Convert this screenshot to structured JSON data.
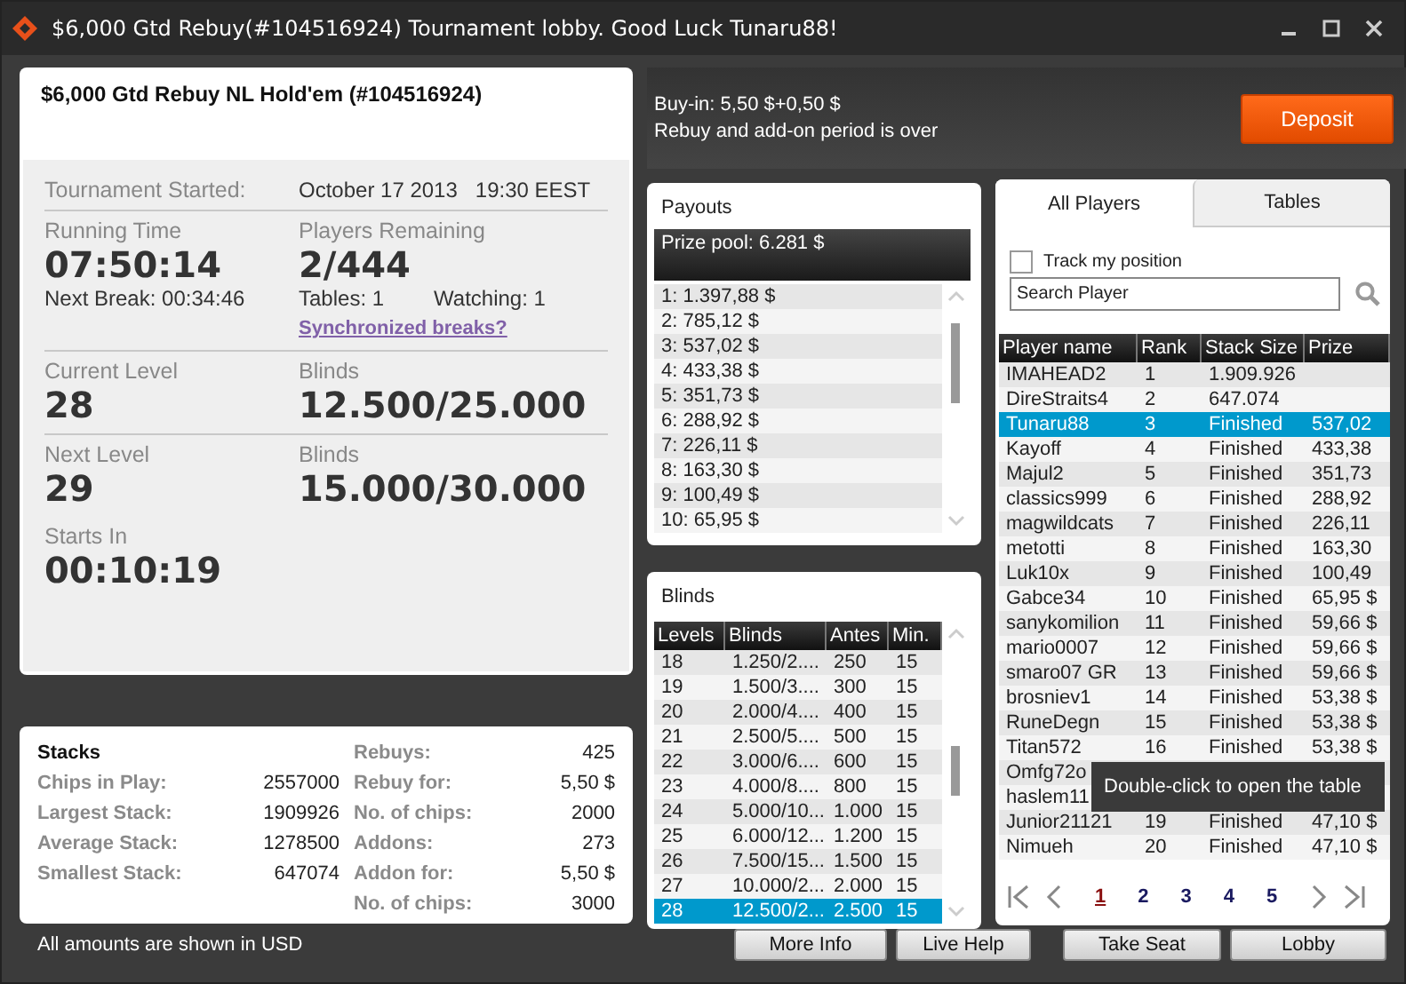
{
  "window": {
    "title": "$6,000 Gtd Rebuy(#104516924) Tournament lobby. Good Luck Tunaru88!"
  },
  "tournament": {
    "name": "$6,000 Gtd Rebuy NL Hold'em (#104516924)",
    "started_label": "Tournament Started:",
    "started_date": "October 17 2013",
    "started_time": "19:30 EEST"
  },
  "running_time": {
    "label": "Running Time",
    "value": "07:50:14"
  },
  "next_break": "Next Break: 00:34:46",
  "players_remaining": {
    "label": "Players Remaining",
    "value": "2/444"
  },
  "tables": "Tables: 1",
  "watching": "Watching: 1",
  "sync_link": "Synchronized breaks?",
  "current_level": {
    "label": "Current Level",
    "value": "28"
  },
  "current_blinds": {
    "label": "Blinds",
    "value": "12.500/25.000"
  },
  "next_level": {
    "label": "Next Level",
    "value": "29"
  },
  "next_blinds": {
    "label": "Blinds",
    "value": "15.000/30.000"
  },
  "starts_in": {
    "label": "Starts In",
    "value": "00:10:19"
  },
  "stacks": {
    "title": "Stacks",
    "rows": [
      {
        "label": "Chips in Play:",
        "value": "2557000"
      },
      {
        "label": "Largest Stack:",
        "value": "1909926"
      },
      {
        "label": "Average Stack:",
        "value": "1278500"
      },
      {
        "label": "Smallest Stack:",
        "value": "647074"
      }
    ]
  },
  "rebuys": {
    "rows": [
      {
        "label": "Rebuys:",
        "value": "425"
      },
      {
        "label": "Rebuy for:",
        "value": "5,50 $"
      },
      {
        "label": "No. of chips:",
        "value": "2000"
      },
      {
        "label": "Addons:",
        "value": "273"
      },
      {
        "label": "Addon for:",
        "value": "5,50 $"
      },
      {
        "label": "No. of chips:",
        "value": "3000"
      }
    ]
  },
  "buyin": {
    "line1": "Buy-in: 5,50 $+0,50 $",
    "line2": "Rebuy and add-on period is over"
  },
  "deposit_button": "Deposit",
  "payouts": {
    "title": "Payouts",
    "prize_pool": "Prize pool: 6.281 $",
    "items": [
      "1: 1.397,88 $",
      "2: 785,12 $",
      "3: 537,02 $",
      "4: 433,38 $",
      "5: 351,73 $",
      "6: 288,92 $",
      "7: 226,11 $",
      "8: 163,30 $",
      "9: 100,49 $",
      "10: 65,95 $"
    ]
  },
  "blinds": {
    "title": "Blinds",
    "columns": [
      "Levels",
      "Blinds",
      "Antes",
      "Min."
    ],
    "rows": [
      {
        "cells": [
          "18",
          "1.250/2....",
          "250",
          "15"
        ],
        "selected": false
      },
      {
        "cells": [
          "19",
          "1.500/3....",
          "300",
          "15"
        ],
        "selected": false
      },
      {
        "cells": [
          "20",
          "2.000/4....",
          "400",
          "15"
        ],
        "selected": false
      },
      {
        "cells": [
          "21",
          "2.500/5....",
          "500",
          "15"
        ],
        "selected": false
      },
      {
        "cells": [
          "22",
          "3.000/6....",
          "600",
          "15"
        ],
        "selected": false
      },
      {
        "cells": [
          "23",
          "4.000/8....",
          "800",
          "15"
        ],
        "selected": false
      },
      {
        "cells": [
          "24",
          "5.000/10...",
          "1.000",
          "15"
        ],
        "selected": false
      },
      {
        "cells": [
          "25",
          "6.000/12...",
          "1.200",
          "15"
        ],
        "selected": false
      },
      {
        "cells": [
          "26",
          "7.500/15...",
          "1.500",
          "15"
        ],
        "selected": false
      },
      {
        "cells": [
          "27",
          "10.000/2...",
          "2.000",
          "15"
        ],
        "selected": false
      },
      {
        "cells": [
          "28",
          "12.500/2...",
          "2.500",
          "15"
        ],
        "selected": true
      }
    ]
  },
  "players": {
    "tabs": [
      {
        "label": "All Players",
        "selected": true
      },
      {
        "label": "Tables",
        "selected": false
      }
    ],
    "track": {
      "label": "Track my position",
      "checked": false
    },
    "search": {
      "placeholder": "Search Player"
    },
    "columns": [
      "Player name",
      "Rank",
      "Stack Size",
      "Prize"
    ],
    "rows": [
      {
        "cells": [
          "IMAHEAD2",
          "1",
          "1.909.926",
          ""
        ],
        "selected": false
      },
      {
        "cells": [
          "DireStraits4",
          "2",
          "647.074",
          ""
        ],
        "selected": false
      },
      {
        "cells": [
          "Tunaru88",
          "3",
          "Finished",
          "537,02"
        ],
        "selected": true
      },
      {
        "cells": [
          "Kayoff",
          "4",
          "Finished",
          "433,38"
        ],
        "selected": false
      },
      {
        "cells": [
          "Majul2",
          "5",
          "Finished",
          "351,73"
        ],
        "selected": false
      },
      {
        "cells": [
          "classics999",
          "6",
          "Finished",
          "288,92"
        ],
        "selected": false
      },
      {
        "cells": [
          "magwildcats",
          "7",
          "Finished",
          "226,11"
        ],
        "selected": false
      },
      {
        "cells": [
          "metotti",
          "8",
          "Finished",
          "163,30"
        ],
        "selected": false
      },
      {
        "cells": [
          "Luk10x",
          "9",
          "Finished",
          "100,49"
        ],
        "selected": false
      },
      {
        "cells": [
          "Gabce34",
          "10",
          "Finished",
          "65,95 $"
        ],
        "selected": false
      },
      {
        "cells": [
          "sanykomilion",
          "11",
          "Finished",
          "59,66 $"
        ],
        "selected": false
      },
      {
        "cells": [
          "mario0007",
          "12",
          "Finished",
          "59,66 $"
        ],
        "selected": false
      },
      {
        "cells": [
          "smaro07 GR",
          "13",
          "Finished",
          "59,66 $"
        ],
        "selected": false
      },
      {
        "cells": [
          "brosniev1",
          "14",
          "Finished",
          "53,38 $"
        ],
        "selected": false
      },
      {
        "cells": [
          "RuneDegn",
          "15",
          "Finished",
          "53,38 $"
        ],
        "selected": false
      },
      {
        "cells": [
          "Titan572",
          "16",
          "Finished",
          "53,38 $"
        ],
        "selected": false
      },
      {
        "cells": [
          "Omfg72o"
        ],
        "selected": false
      },
      {
        "cells": [
          "haslem11"
        ],
        "selected": false
      },
      {
        "cells": [
          "Junior21121",
          "19",
          "Finished",
          "47,10 $"
        ],
        "selected": false
      },
      {
        "cells": [
          "Nimueh",
          "20",
          "Finished",
          "47,10 $"
        ],
        "selected": false
      }
    ],
    "pages": [
      {
        "label": "1",
        "selected": true
      },
      {
        "label": "2",
        "selected": false
      },
      {
        "label": "3",
        "selected": false
      },
      {
        "label": "4",
        "selected": false
      },
      {
        "label": "5",
        "selected": false
      }
    ],
    "tooltip": "Double-click to open the table"
  },
  "footer_note": "All amounts are shown in USD",
  "buttons": [
    "More Info",
    "Live Help",
    "Take Seat",
    "Lobby"
  ]
}
